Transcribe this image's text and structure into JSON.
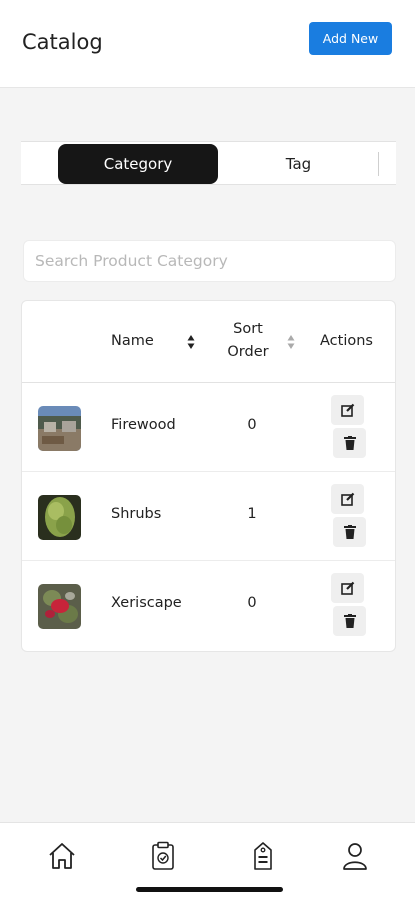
{
  "header": {
    "title": "Catalog",
    "add_label": "Add New",
    "accent": "#1a7de0"
  },
  "tabs": [
    {
      "label": "Category",
      "active": true
    },
    {
      "label": "Tag",
      "active": false
    }
  ],
  "search": {
    "placeholder": "Search Product Category",
    "value": ""
  },
  "table": {
    "columns": {
      "name": "Name",
      "sort_order_line1": "Sort",
      "sort_order_line2": "Order",
      "actions": "Actions"
    },
    "rows": [
      {
        "name": "Firewood",
        "sort_order": "0",
        "thumb_icon": "firewood-photo"
      },
      {
        "name": "Shrubs",
        "sort_order": "1",
        "thumb_icon": "shrubs-photo"
      },
      {
        "name": "Xeriscape",
        "sort_order": "0",
        "thumb_icon": "xeriscape-photo"
      }
    ],
    "row_action_icons": [
      "edit-icon",
      "trash-icon"
    ]
  },
  "bottom_nav": {
    "items": [
      {
        "icon": "home-icon"
      },
      {
        "icon": "clipboard-check-icon"
      },
      {
        "icon": "price-tag-icon"
      },
      {
        "icon": "user-icon"
      }
    ]
  }
}
